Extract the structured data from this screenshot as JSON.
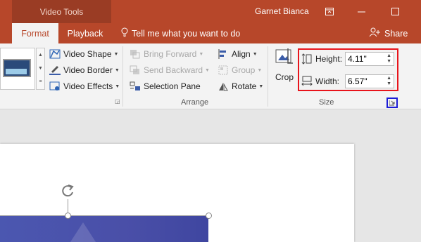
{
  "titlebar": {
    "contextual_label": "Video Tools",
    "user": "Garnet Bianca"
  },
  "tabs": {
    "format": "Format",
    "playback": "Playback",
    "tell_me": "Tell me what you want to do",
    "share": "Share"
  },
  "video_styles": {
    "shape": "Video Shape",
    "border": "Video Border",
    "effects": "Video Effects"
  },
  "arrange": {
    "bring_forward": "Bring Forward",
    "send_backward": "Send Backward",
    "selection_pane": "Selection Pane",
    "align": "Align",
    "group": "Group",
    "rotate": "Rotate",
    "label": "Arrange"
  },
  "size": {
    "crop": "Crop",
    "height_label": "Height:",
    "height_value": "4.11\"",
    "width_label": "Width:",
    "width_value": "6.57\"",
    "label": "Size"
  },
  "colors": {
    "accent": "#b7472a",
    "highlight_red": "#e8141b",
    "highlight_blue": "#1c1cd6"
  }
}
